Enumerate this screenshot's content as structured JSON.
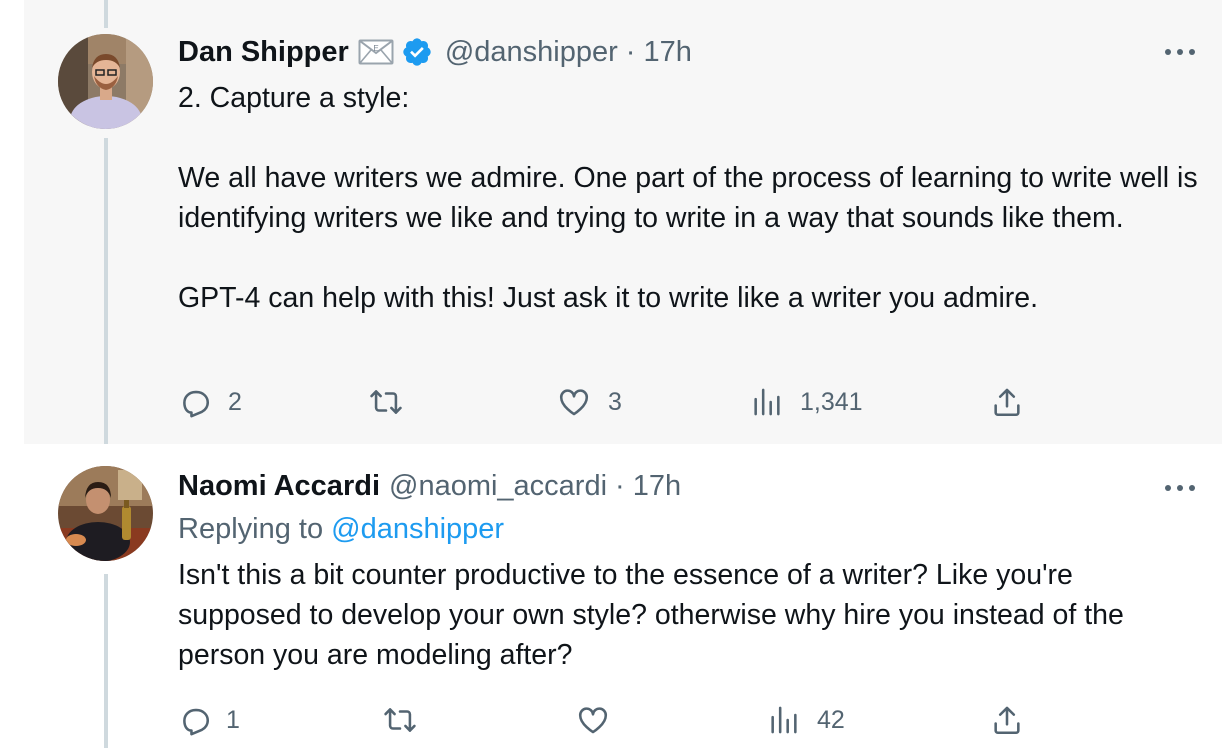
{
  "tweets": [
    {
      "author_name": "Dan Shipper",
      "handle": "@danshipper",
      "separator": "·",
      "time": "17h",
      "text": "2. Capture a style:\n\nWe all have writers we admire. One part of the process of learning to write well is identifying writers we like and trying to write in a way that sounds like them.\n\nGPT-4 can help with this! Just ask it to write like a writer you admire.",
      "badges": [
        "envelope-icon",
        "verified-badge-icon"
      ],
      "actions": {
        "replies": "2",
        "retweets": "",
        "likes": "3",
        "views": "1,341"
      }
    },
    {
      "author_name": "Naomi Accardi",
      "handle": "@naomi_accardi",
      "separator": "·",
      "time": "17h",
      "replying_label": "Replying to ",
      "replying_mention": "@danshipper",
      "text": "Isn't this a bit counter productive to the essence of a writer? Like you're supposed to develop your own style? otherwise why hire you instead of the person you are modeling after?",
      "actions": {
        "replies": "1",
        "retweets": "",
        "likes": "",
        "views": "42"
      }
    }
  ],
  "icons": {
    "reply": "speech-bubble-icon",
    "retweet": "retweet-arrows-icon",
    "like": "heart-icon",
    "views": "bar-chart-icon",
    "share": "share-upload-icon",
    "more": "three-dots-icon"
  },
  "colors": {
    "text": "#0f1419",
    "secondary": "#536471",
    "link": "#1d9bf0",
    "verified": "#1d9bf0",
    "highlight_background": "#f7f7f7",
    "thread_line": "#cfd9de"
  }
}
